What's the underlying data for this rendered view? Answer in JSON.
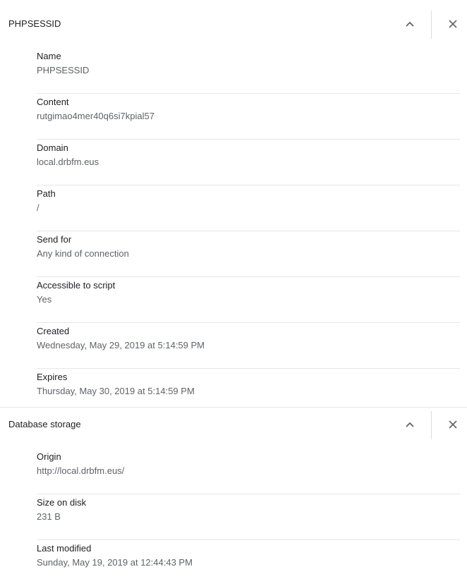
{
  "cookie_section": {
    "title": "PHPSESSID",
    "expand_icon": "chevron-up-icon",
    "close_icon": "close-icon",
    "rows": [
      {
        "label": "Name",
        "value": "PHPSESSID"
      },
      {
        "label": "Content",
        "value": "rutgimao4mer40q6si7kpial57"
      },
      {
        "label": "Domain",
        "value": "local.drbfm.eus"
      },
      {
        "label": "Path",
        "value": "/"
      },
      {
        "label": "Send for",
        "value": "Any kind of connection"
      },
      {
        "label": "Accessible to script",
        "value": "Yes"
      },
      {
        "label": "Created",
        "value": "Wednesday, May 29, 2019 at 5:14:59 PM"
      },
      {
        "label": "Expires",
        "value": "Thursday, May 30, 2019 at 5:14:59 PM"
      }
    ]
  },
  "database_section": {
    "title": "Database storage",
    "expand_icon": "chevron-up-icon",
    "close_icon": "close-icon",
    "rows": [
      {
        "label": "Origin",
        "value": "http://local.drbfm.eus/"
      },
      {
        "label": "Size on disk",
        "value": "231 B"
      },
      {
        "label": "Last modified",
        "value": "Sunday, May 19, 2019 at 12:44:43 PM"
      }
    ]
  },
  "colors": {
    "text_primary": "#202124",
    "text_secondary": "#5f6368",
    "divider": "#e6e6e6",
    "icon": "#5f6368"
  }
}
